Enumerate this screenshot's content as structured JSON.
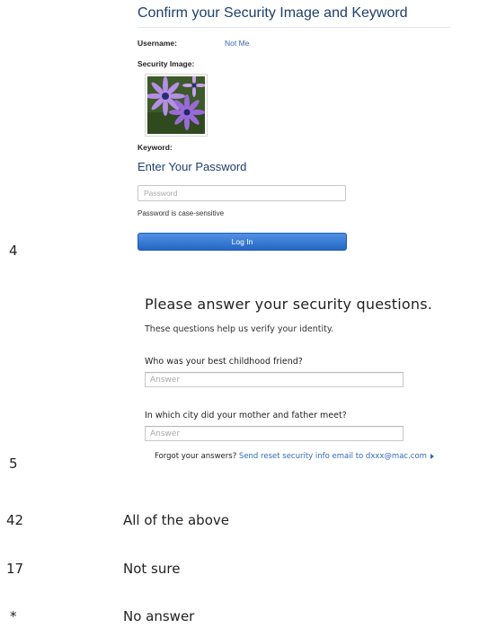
{
  "panel1": {
    "title": "Confirm your Security Image and Keyword",
    "username_label": "Username:",
    "not_me_link": "Not Me",
    "security_image_label": "Security Image:",
    "keyword_label": "Keyword:",
    "password_heading": "Enter Your Password",
    "password_placeholder": "Password",
    "case_note": "Password is case-sensitive",
    "login_button": "Log In"
  },
  "row_numbers": [
    "4",
    "5"
  ],
  "panel2": {
    "title": "Please answer your security questions.",
    "subtitle": "These questions help us verify your identity.",
    "questions": [
      {
        "label": "Who was your best childhood friend?",
        "placeholder": "Answer"
      },
      {
        "label": "In which city did your mother and father meet?",
        "placeholder": "Answer"
      }
    ],
    "forgot_prefix": "Forgot your answers?",
    "forgot_link": "Send reset security info email to dxxx@mac.com"
  },
  "options": [
    {
      "number": "42",
      "label": "All of the above"
    },
    {
      "number": "17",
      "label": "Not sure"
    },
    {
      "number": "*",
      "label": "No answer"
    }
  ],
  "colors": {
    "title_blue": "#1d3f6e",
    "link_blue": "#3a67b0",
    "button_blue": "#2566c4"
  }
}
